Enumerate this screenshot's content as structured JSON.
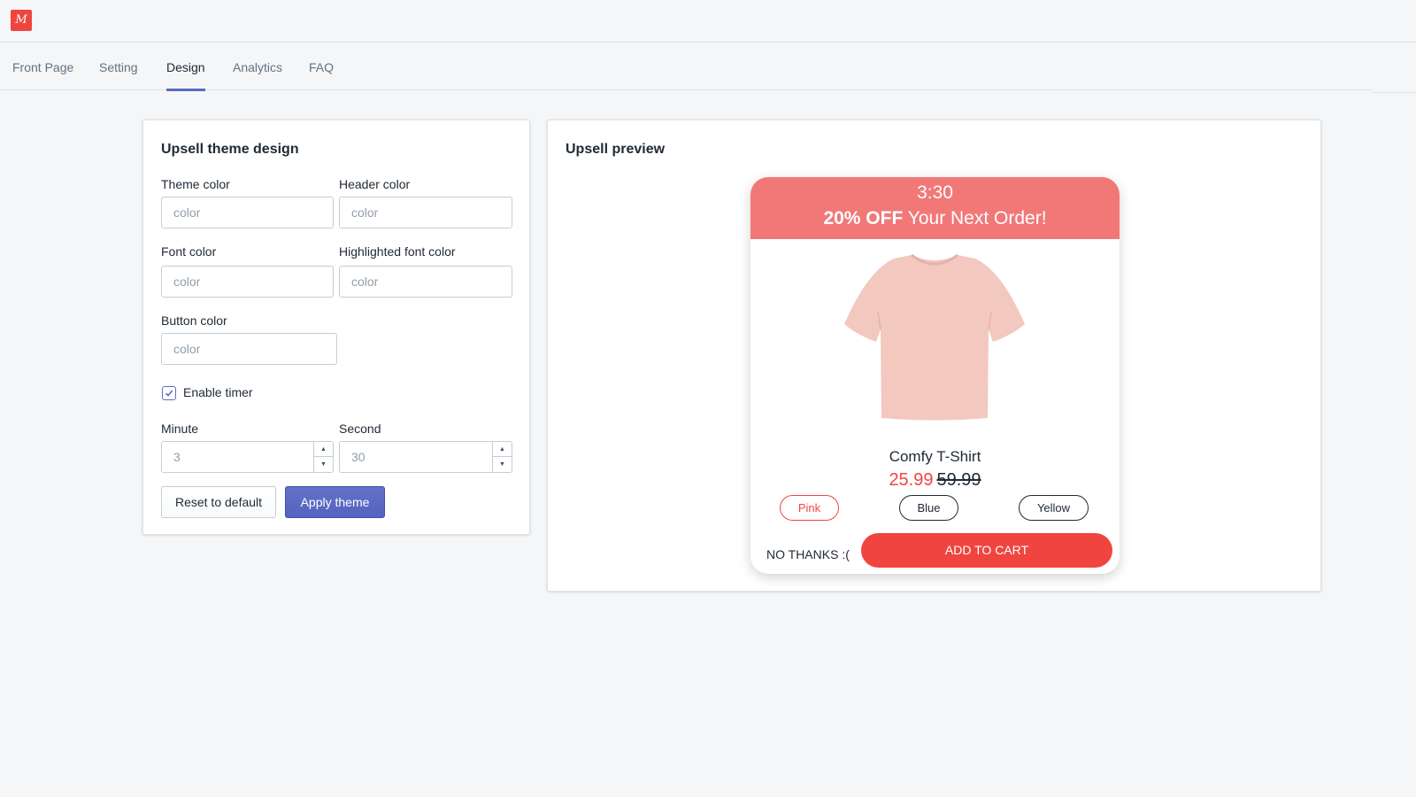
{
  "app": {
    "logo_icon": "brand-logo-icon",
    "logo_color": "#f0453f"
  },
  "tabs": [
    {
      "label": "Front Page",
      "active": false
    },
    {
      "label": "Setting",
      "active": false
    },
    {
      "label": "Design",
      "active": true
    },
    {
      "label": "Analytics",
      "active": false
    },
    {
      "label": "FAQ",
      "active": false
    }
  ],
  "design_card": {
    "title": "Upsell theme design",
    "fields": {
      "theme_color": {
        "label": "Theme color",
        "placeholder": "color",
        "value": ""
      },
      "header_color": {
        "label": "Header color",
        "placeholder": "color",
        "value": ""
      },
      "font_color": {
        "label": "Font color",
        "placeholder": "color",
        "value": ""
      },
      "highlighted_font_color": {
        "label": "Highlighted font color",
        "placeholder": "color",
        "value": ""
      },
      "button_color": {
        "label": "Button color",
        "placeholder": "color",
        "value": ""
      }
    },
    "enable_timer": {
      "label": "Enable timer",
      "checked": true
    },
    "minute": {
      "label": "Minute",
      "value": "3"
    },
    "second": {
      "label": "Second",
      "value": "30"
    },
    "reset_label": "Reset to default",
    "apply_label": "Apply theme",
    "accent_color": "#5c6ac4"
  },
  "preview_card": {
    "title": "Upsell preview",
    "popup": {
      "timer": "3:30",
      "headline_bold": "20% OFF",
      "headline_rest": " Your Next Order!",
      "header_color": "#f27878",
      "product_image_icon": "tshirt-image",
      "product_name": "Comfy T-Shirt",
      "price_new": "25.99",
      "price_old": "59.99",
      "variants": [
        {
          "label": "Pink",
          "selected": true
        },
        {
          "label": "Blue",
          "selected": false
        },
        {
          "label": "Yellow",
          "selected": false
        }
      ],
      "no_thanks": "NO THANKS :(",
      "add_to_cart": "ADD TO CART",
      "button_color": "#f0453f"
    }
  }
}
